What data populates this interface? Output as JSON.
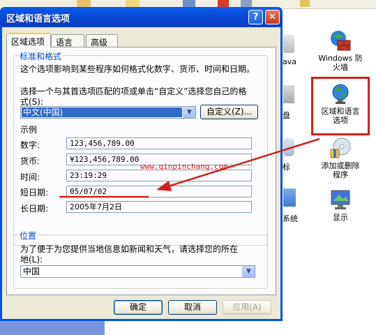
{
  "dialog": {
    "title": "区域和语言选项",
    "help_label": "?",
    "close_label": "✕",
    "tabs": [
      {
        "label": "区域选项",
        "active": true
      },
      {
        "label": "语言",
        "active": false
      },
      {
        "label": "高级",
        "active": false
      }
    ],
    "standards": {
      "group_label": "标准和格式",
      "description": "这个选项影响到某些程序如何格式化数字、货币、时间和日期。",
      "instruction_line1": "选择一个与其首选项匹配的项或单击“自定义”选择您自己的格",
      "instruction_line2": "式(S):",
      "selected_format": "中文(中国)",
      "customize_button": "自定义(Z)..."
    },
    "samples": {
      "label": "示例",
      "rows": [
        {
          "label": "数字:",
          "value": "123,456,789.00"
        },
        {
          "label": "货币:",
          "value": "¥123,456,789.00"
        },
        {
          "label": "时间:",
          "value": "23:19:29"
        },
        {
          "label": "短日期:",
          "value": "05/07/02"
        },
        {
          "label": "长日期:",
          "value": "2005年7月2日"
        }
      ]
    },
    "location": {
      "group_label": "位置",
      "description_line1": "为了便于为您提供当地信息如新闻和天气，请选择您的所在",
      "description_line2": "地(L):",
      "selected_location": "中国"
    },
    "buttons": {
      "ok": "确定",
      "cancel": "取消",
      "apply": "应用(A)"
    }
  },
  "control_panel": {
    "items": [
      {
        "label_line1": "Windows 防",
        "label_line2": "火墙"
      },
      {
        "label_line1": "区域和语言",
        "label_line2": "选项"
      },
      {
        "label_line1": "添加或删除",
        "label_line2": "程序"
      },
      {
        "label_line1": "显示",
        "label_line2": ""
      }
    ],
    "partial_labels": [
      "ava",
      "盘",
      "标",
      "系统"
    ]
  },
  "watermark": "www.qinpinchang.com",
  "colors": {
    "title_bar": "#0054e3",
    "annotation_red": "#d0201c",
    "group_label_blue": "#0046d5",
    "selection_blue": "#316ac5"
  }
}
